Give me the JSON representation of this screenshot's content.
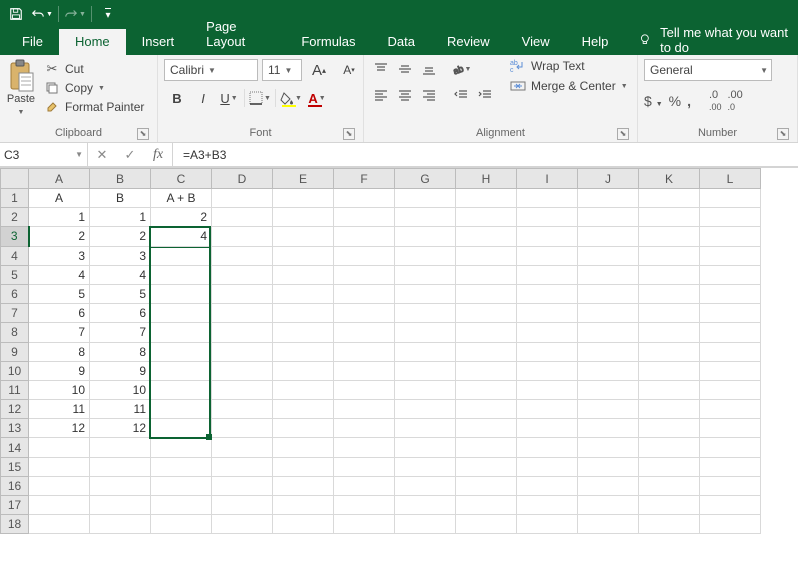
{
  "titlebar": {
    "icons": [
      "save",
      "undo",
      "redo"
    ]
  },
  "tabs": [
    "File",
    "Home",
    "Insert",
    "Page Layout",
    "Formulas",
    "Data",
    "Review",
    "View",
    "Help"
  ],
  "active_tab": "Home",
  "tellme": "Tell me what you want to do",
  "clipboard": {
    "paste": "Paste",
    "cut": "Cut",
    "copy": "Copy",
    "format_painter": "Format Painter",
    "label": "Clipboard"
  },
  "font": {
    "name": "Calibri",
    "size": "11",
    "label": "Font"
  },
  "alignment": {
    "wrap": "Wrap Text",
    "merge": "Merge & Center",
    "label": "Alignment"
  },
  "number": {
    "format": "General",
    "label": "Number"
  },
  "formula_bar": {
    "cell_ref": "C3",
    "formula": "=A3+B3"
  },
  "columns": [
    "A",
    "B",
    "C",
    "D",
    "E",
    "F",
    "G",
    "H",
    "I",
    "J",
    "K",
    "L"
  ],
  "rows": [
    {
      "n": 1,
      "A": "A",
      "B": "B",
      "C": "A + B",
      "center": true
    },
    {
      "n": 2,
      "A": "1",
      "B": "1",
      "C": "2"
    },
    {
      "n": 3,
      "A": "2",
      "B": "2",
      "C": "4"
    },
    {
      "n": 4,
      "A": "3",
      "B": "3",
      "C": ""
    },
    {
      "n": 5,
      "A": "4",
      "B": "4",
      "C": ""
    },
    {
      "n": 6,
      "A": "5",
      "B": "5",
      "C": ""
    },
    {
      "n": 7,
      "A": "6",
      "B": "6",
      "C": ""
    },
    {
      "n": 8,
      "A": "7",
      "B": "7",
      "C": ""
    },
    {
      "n": 9,
      "A": "8",
      "B": "8",
      "C": ""
    },
    {
      "n": 10,
      "A": "9",
      "B": "9",
      "C": ""
    },
    {
      "n": 11,
      "A": "10",
      "B": "10",
      "C": ""
    },
    {
      "n": 12,
      "A": "11",
      "B": "11",
      "C": ""
    },
    {
      "n": 13,
      "A": "12",
      "B": "12",
      "C": ""
    },
    {
      "n": 14
    },
    {
      "n": 15
    },
    {
      "n": 16
    },
    {
      "n": 17
    },
    {
      "n": 18
    }
  ],
  "selected_row": 3,
  "selection": {
    "col": "C",
    "row_start": 3,
    "row_end": 13
  }
}
